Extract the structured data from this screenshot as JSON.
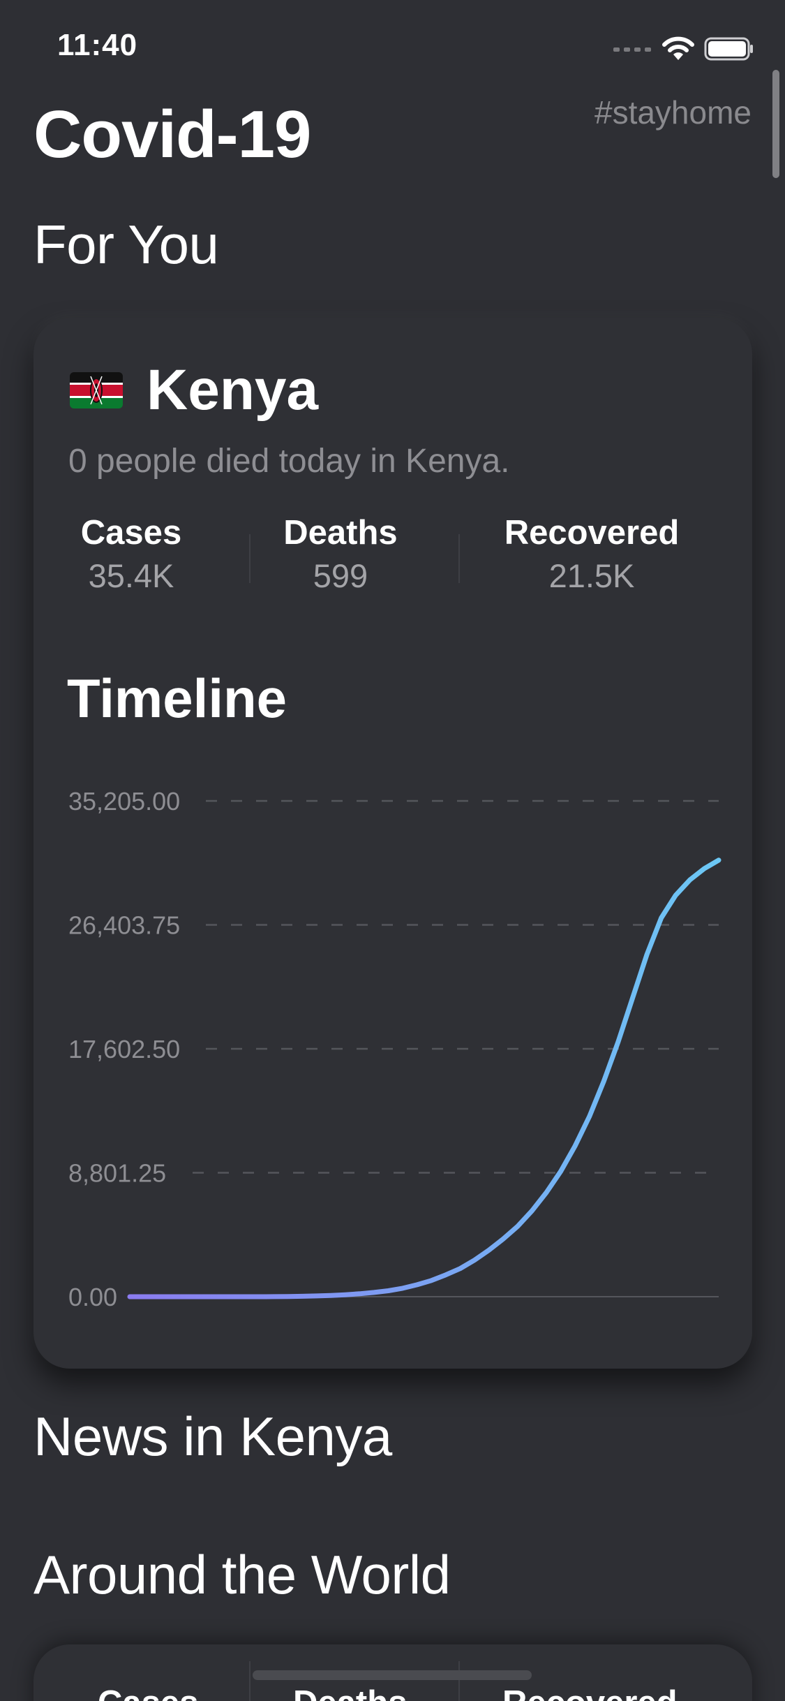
{
  "status_bar": {
    "time": "11:40"
  },
  "header": {
    "title": "Covid-19",
    "hashtag": "#stayhome"
  },
  "sections": {
    "for_you": "For You",
    "news": "News in Kenya",
    "world": "Around the World"
  },
  "country_card": {
    "country": "Kenya",
    "summary": "0 people died today in Kenya.",
    "stats": [
      {
        "label": "Cases",
        "value": "35.4K"
      },
      {
        "label": "Deaths",
        "value": "599"
      },
      {
        "label": "Recovered",
        "value": "21.5K"
      }
    ],
    "timeline_title": "Timeline"
  },
  "world_card": {
    "labels": [
      "Cases",
      "Deaths",
      "Recovered"
    ]
  },
  "colors": {
    "background": "#2e2f34",
    "card": "#2f3035",
    "line_start": "#8b7cf0",
    "line_end": "#6cc8f5",
    "muted_text": "#8e8e93"
  },
  "chart_data": {
    "type": "line",
    "title": "Timeline",
    "y_ticks": [
      "35,205.00",
      "26,403.75",
      "17,602.50",
      "8,801.25",
      "0.00"
    ],
    "ylim": [
      0,
      35205
    ],
    "grid": "dashed horizontal",
    "series": [
      {
        "values": [
          0,
          0,
          0,
          0,
          0,
          0,
          0,
          0,
          0,
          0,
          5,
          15,
          30,
          55,
          90,
          140,
          210,
          300,
          420,
          600,
          850,
          1150,
          1550,
          2000,
          2600,
          3300,
          4100,
          5000,
          6100,
          7400,
          8900,
          10700,
          12800,
          15300,
          18100,
          21200,
          24300,
          26900,
          28500,
          29600,
          30400,
          31000
        ]
      }
    ]
  }
}
